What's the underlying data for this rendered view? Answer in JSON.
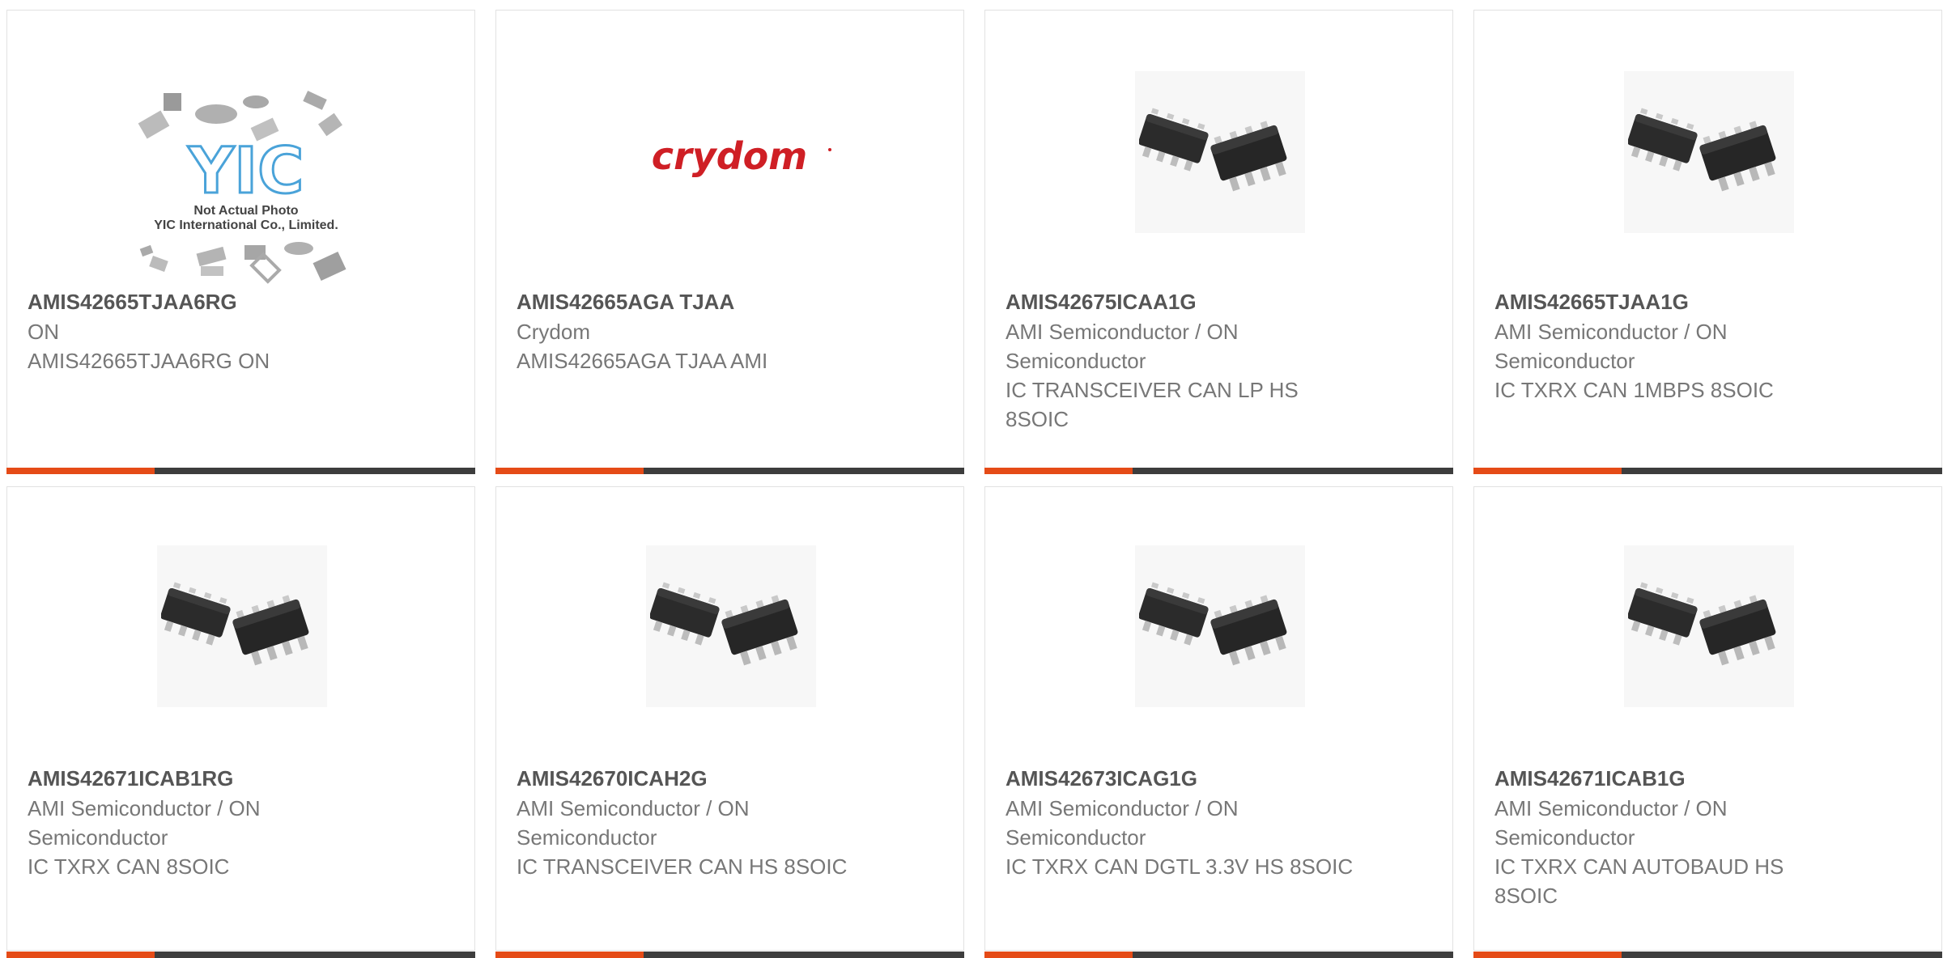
{
  "accent_color": "#e54b17",
  "bar_color": "#3d3d3d",
  "products": [
    {
      "image": "yic-not-actual-photo-image",
      "image_text_line1": "Not Actual Photo",
      "image_text_line2": "YIC International Co., Limited.",
      "image_logo": "YIC",
      "part": "AMIS42665TJAA6RG",
      "manufacturer": "ON",
      "description": "AMIS42665TJAA6RG ON"
    },
    {
      "image": "crydom-logo-image",
      "image_logo": "crydom",
      "part": "AMIS42665AGA TJAA",
      "manufacturer": "Crydom",
      "description": "AMIS42665AGA TJAA AMI"
    },
    {
      "image": "soic-chip-image",
      "part": "AMIS42675ICAA1G",
      "manufacturer": "AMI Semiconductor / ON Semiconductor",
      "description": "IC TRANSCEIVER CAN LP HS 8SOIC"
    },
    {
      "image": "soic-chip-image",
      "part": "AMIS42665TJAA1G",
      "manufacturer": "AMI Semiconductor / ON Semiconductor",
      "description": "IC TXRX CAN 1MBPS 8SOIC"
    },
    {
      "image": "soic-chip-image",
      "part": "AMIS42671ICAB1RG",
      "manufacturer": "AMI Semiconductor / ON Semiconductor",
      "description": "IC TXRX CAN 8SOIC"
    },
    {
      "image": "soic-chip-image",
      "part": "AMIS42670ICAH2G",
      "manufacturer": "AMI Semiconductor / ON Semiconductor",
      "description": "IC TRANSCEIVER CAN HS 8SOIC"
    },
    {
      "image": "soic-chip-image",
      "part": "AMIS42673ICAG1G",
      "manufacturer": "AMI Semiconductor / ON Semiconductor",
      "description": "IC TXRX CAN DGTL 3.3V HS 8SOIC"
    },
    {
      "image": "soic-chip-image",
      "part": "AMIS42671ICAB1G",
      "manufacturer": "AMI Semiconductor / ON Semiconductor",
      "description": "IC TXRX CAN AUTOBAUD HS 8SOIC"
    }
  ]
}
